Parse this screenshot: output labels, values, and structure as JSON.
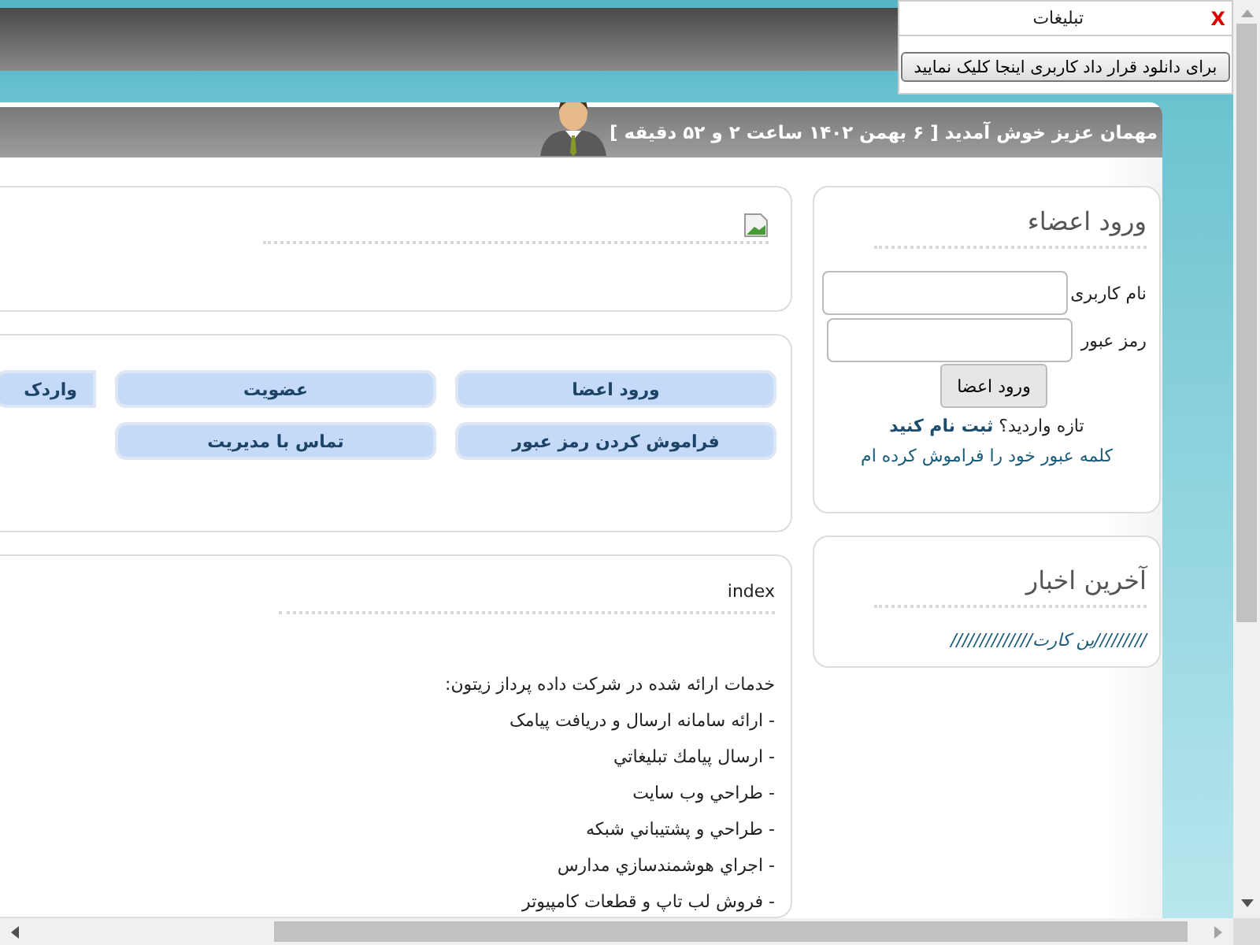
{
  "popup": {
    "title": "تبلیغات",
    "close": "X",
    "button": "برای دانلود قرار داد کاربری اینجا کلیک نمایید"
  },
  "header": {
    "welcome": "مهمان عزیز خوش آمدید [ ۶ بهمن ۱۴۰۲ ساعت ۲ و ۵۲ دقیقه ]"
  },
  "login": {
    "title": "ورود اعضاء",
    "fields": [
      {
        "label": "نام کاربری"
      },
      {
        "label": "رمز عبور"
      }
    ],
    "button": "ورود اعضا",
    "signup_prompt": "تازه واردید؟",
    "signup_link": "ثبت نام کنید",
    "forgot_link": "کلمه عبور خود را فراموش کرده ام"
  },
  "news": {
    "title": "آخرین اخبار",
    "items": [
      "/////////ین کارت//////////////"
    ]
  },
  "nav_buttons": [
    [
      "ورود اعضا",
      "عضویت",
      "واردک"
    ],
    [
      "فراموش کردن رمز عبور",
      "تماس با مدیریت"
    ]
  ],
  "content": {
    "title": "index",
    "intro": "خدمات ارائه شده در شرکت داده پرداز زیتون:",
    "items": [
      "- ارائه سامانه ارسال و دریافت پیامک",
      "- ارسال پیامك تبلیغاتي",
      "- طراحي وب سايت",
      "- طراحي و پشتيباني شبكه",
      "- اجراي هوشمندسازي مدارس",
      "- فروش لب تاپ و قطعات كامپيوتر"
    ]
  }
}
